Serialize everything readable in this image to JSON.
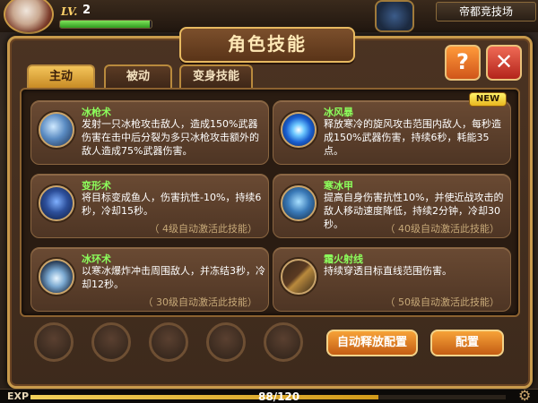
{
  "hud": {
    "level_label": "LV.",
    "level_value": "2",
    "hp_fraction": 0.98,
    "arena_label": "帝都竞技场"
  },
  "dialog": {
    "title": "角色技能",
    "help_label": "?",
    "close_label": "✕"
  },
  "tabs": [
    {
      "label": "主动",
      "active": true
    },
    {
      "label": "被动",
      "active": false
    },
    {
      "label": "变身技能",
      "active": false
    }
  ],
  "skills": [
    {
      "name": "冰枪术",
      "desc": "发射一只冰枪攻击敌人，造成150%武器伤害在击中后分裂为多只冰枪攻击额外的敌人造成75%武器伤害。",
      "note": "",
      "new": false,
      "icon": "ice-spear-icon"
    },
    {
      "name": "冰风暴",
      "desc": "释放寒冷的旋风攻击范围内敌人，每秒造成150%武器伤害，持续6秒，耗能35点。",
      "note": "",
      "new": true,
      "new_label": "NEW",
      "icon": "ice-storm-icon"
    },
    {
      "name": "变形术",
      "desc": "将目标变成鱼人，伤害抗性-10%，持续6秒，冷却15秒。",
      "note": "（ 4级自动激活此技能）",
      "new": false,
      "icon": "polymorph-icon"
    },
    {
      "name": "寒冰甲",
      "desc": "提高自身伤害抗性10%，并使近战攻击的敌人移动速度降低，持续2分钟，冷却30秒。",
      "note": "（ 40级自动激活此技能）",
      "new": false,
      "icon": "ice-armor-icon"
    },
    {
      "name": "冰环术",
      "desc": "以寒冰爆炸冲击周围敌人，并冻结3秒，冷却12秒。",
      "note": "（ 30级自动激活此技能）",
      "new": false,
      "icon": "frost-nova-icon"
    },
    {
      "name": "霜火射线",
      "desc": "持续穿透目标直线范围伤害。",
      "note": "（ 50级自动激活此技能）",
      "new": false,
      "icon": "frostfire-ray-icon"
    }
  ],
  "skill_slots_count": 5,
  "buttons": {
    "auto_release": "自动释放配置",
    "configure": "配置"
  },
  "exp": {
    "label": "EXP",
    "text": "88/120",
    "fraction": 0.733
  }
}
